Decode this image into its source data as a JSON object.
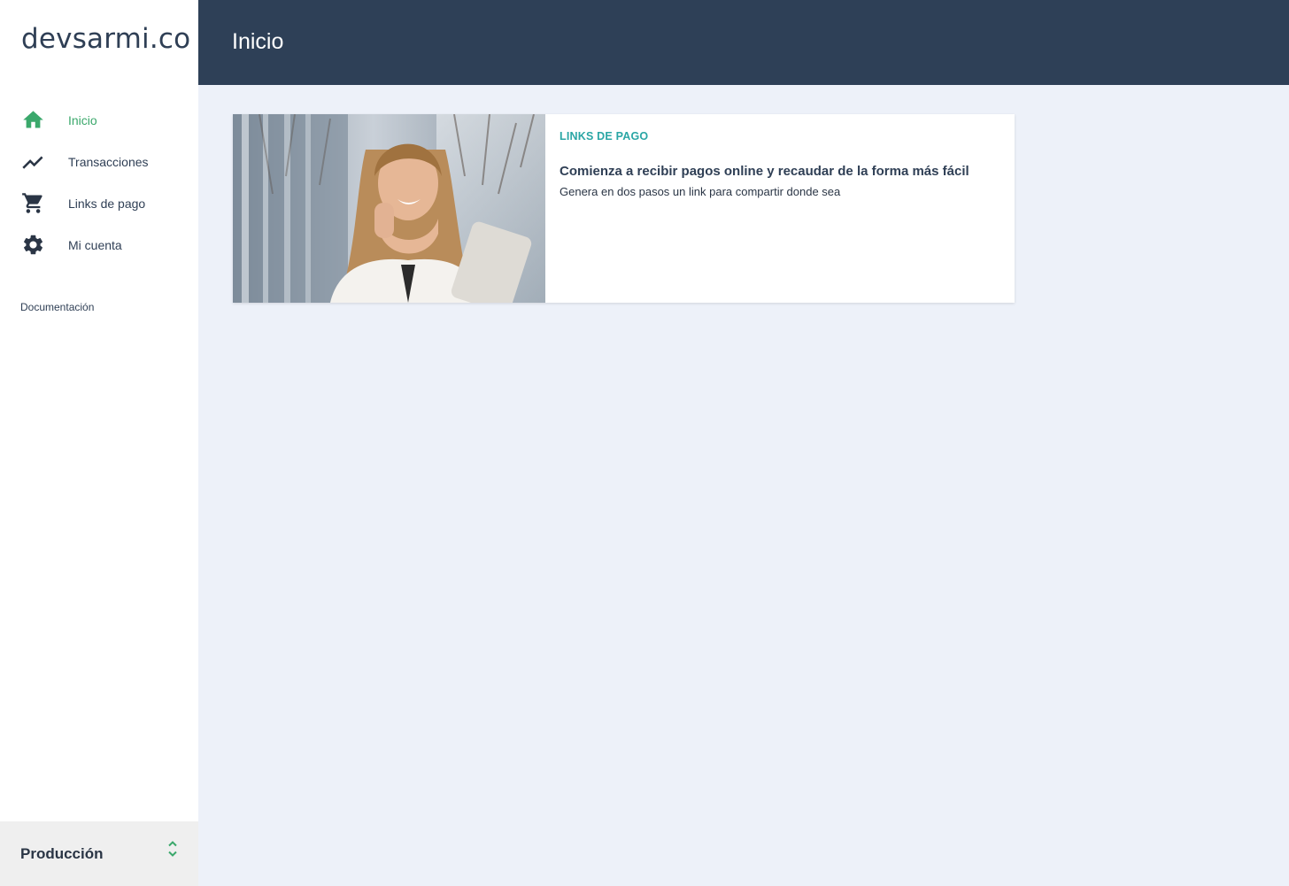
{
  "brand": {
    "name": "devsarmi.co"
  },
  "sidebar": {
    "items": [
      {
        "label": "Inicio",
        "icon": "home-icon",
        "active": true
      },
      {
        "label": "Transacciones",
        "icon": "trending-icon",
        "active": false
      },
      {
        "label": "Links de pago",
        "icon": "cart-icon",
        "active": false
      },
      {
        "label": "Mi cuenta",
        "icon": "gear-icon",
        "active": false
      }
    ],
    "docs_label": "Documentación",
    "environment": {
      "label": "Producción",
      "icon": "unfold-chevrons-icon"
    }
  },
  "header": {
    "title": "Inicio"
  },
  "card": {
    "eyebrow": "LINKS DE PAGO",
    "headline": "Comienza a recibir pagos online y recaudar de la forma más fácil",
    "description": "Genera en dos pasos un link para compartir donde sea",
    "image": "woman-on-phone-with-tablet-photo"
  },
  "colors": {
    "sidebar_bg": "#ffffff",
    "header_bg": "#2e4057",
    "content_bg": "#edf1f9",
    "active_green": "#3aa86b",
    "eyebrow_teal": "#2aa6a5",
    "text_dark": "#2f3f55"
  }
}
